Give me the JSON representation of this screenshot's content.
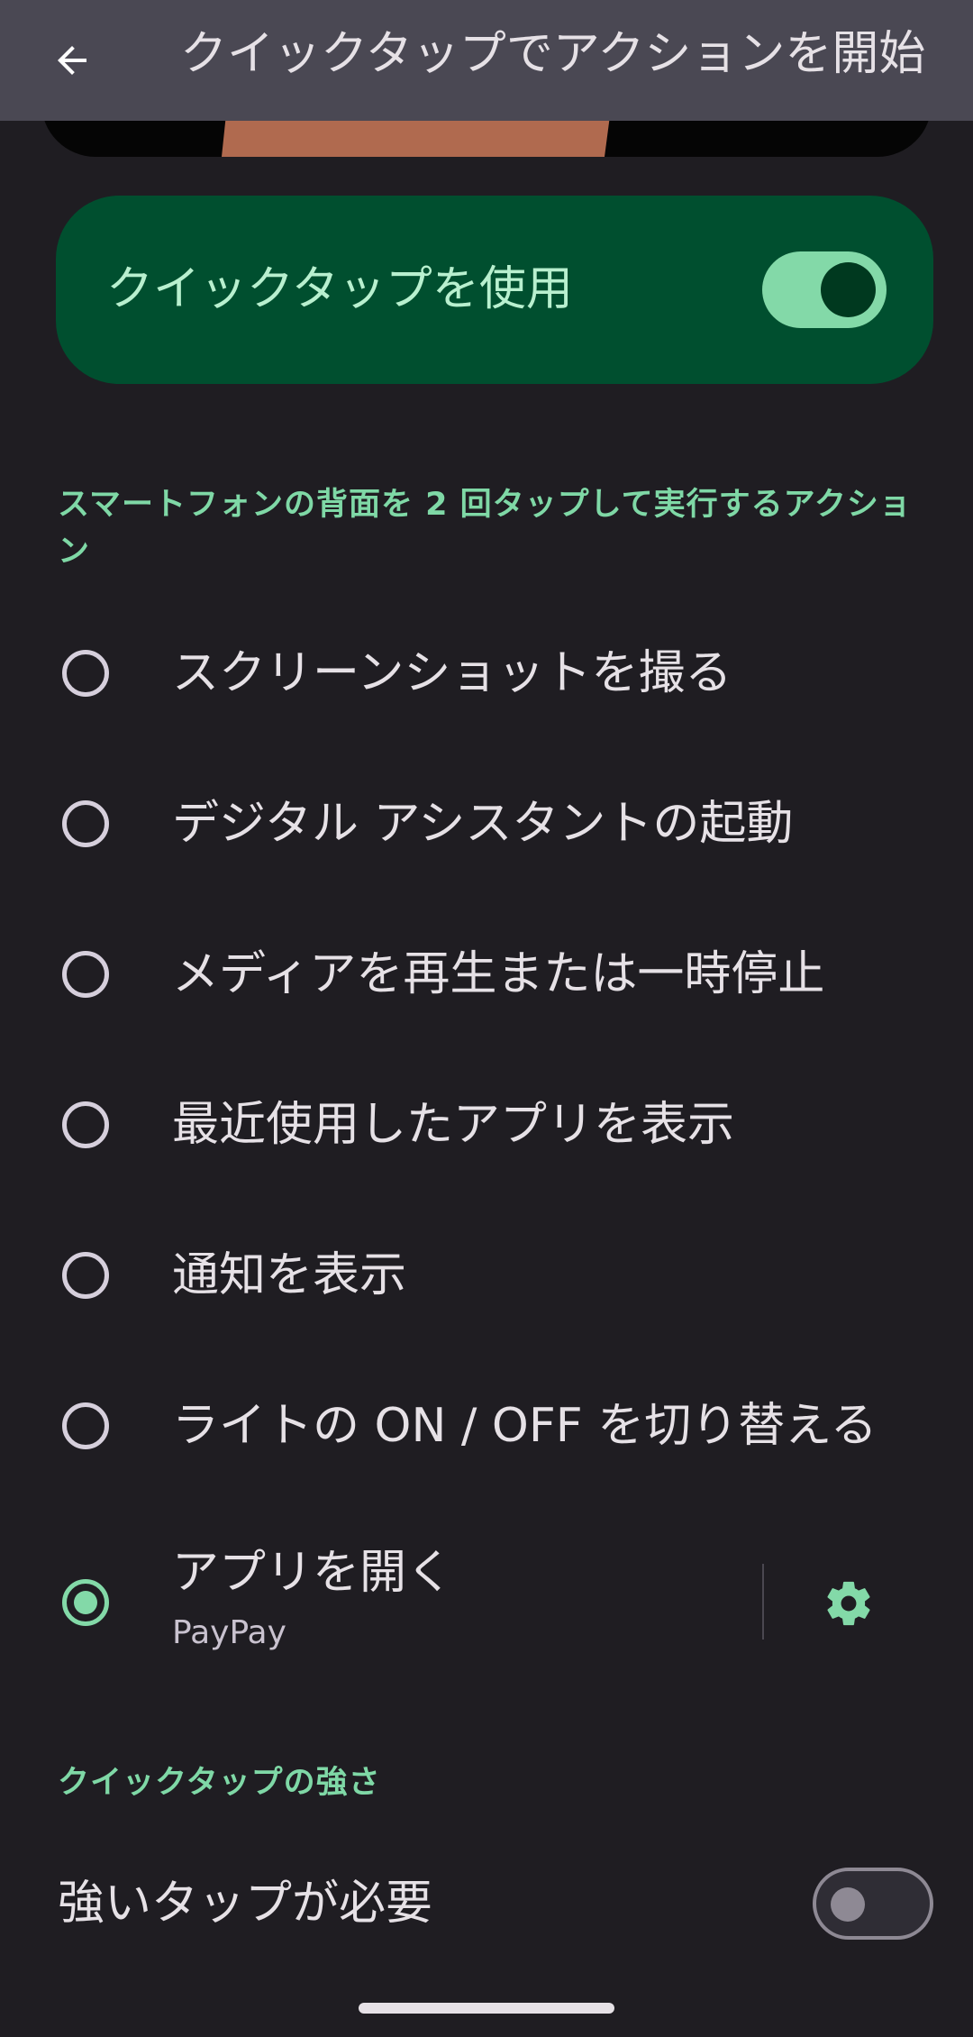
{
  "app_bar": {
    "title": "クイックタップでアクションを開始",
    "back_icon": "arrow-back-icon"
  },
  "master": {
    "label": "クイックタップを使用",
    "enabled": true
  },
  "actions_section": {
    "header": "スマートフォンの背面を 2 回タップして実行するアクション",
    "options": [
      {
        "label": "スクリーンショットを撮る",
        "selected": false
      },
      {
        "label": "デジタル アシスタントの起動",
        "selected": false
      },
      {
        "label": "メディアを再生または一時停止",
        "selected": false
      },
      {
        "label": "最近使用したアプリを表示",
        "selected": false
      },
      {
        "label": "通知を表示",
        "selected": false
      },
      {
        "label": "ライトの ON / OFF を切り替える",
        "selected": false
      },
      {
        "label": "アプリを開く",
        "sublabel": "PayPay",
        "selected": true,
        "settings_icon": "gear-icon"
      }
    ]
  },
  "strength_section": {
    "header": "クイックタップの強さ",
    "strong_tap_label": "強いタップが必要",
    "strong_tap_enabled": false
  },
  "colors": {
    "background": "#1f1d22",
    "app_bar": "#4a4853",
    "accent": "#83d9a8",
    "card": "#004f2f"
  }
}
